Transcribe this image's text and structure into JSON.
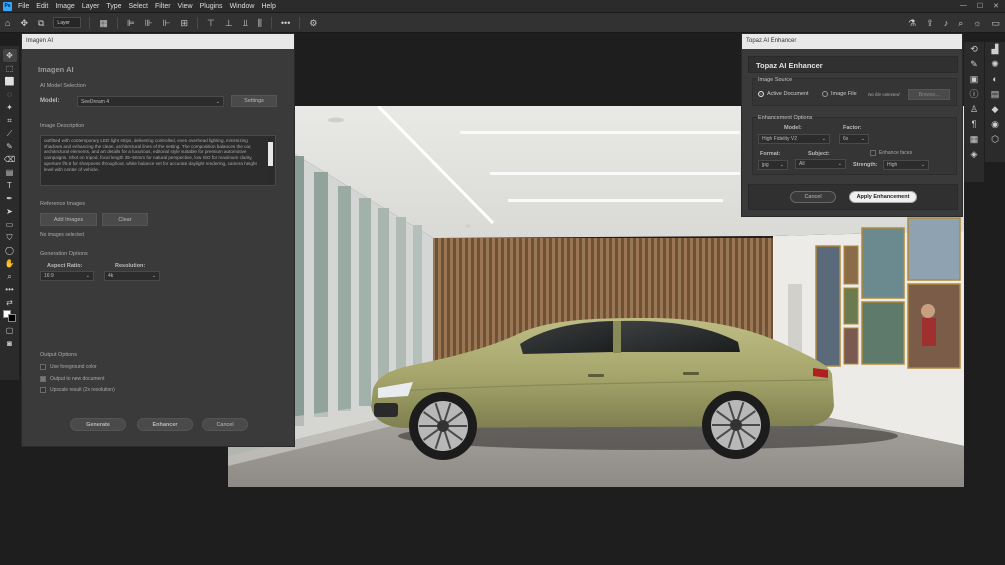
{
  "menubar": {
    "logo": "Ps",
    "items": [
      "File",
      "Edit",
      "Image",
      "Layer",
      "Type",
      "Select",
      "Filter",
      "View",
      "Plugins",
      "Window",
      "Help"
    ],
    "window_controls": [
      "—",
      "☐",
      "✕"
    ]
  },
  "options_bar": {
    "layer_select": "Layer",
    "icons": [
      "home-icon",
      "move-icon",
      "auto-select-icon",
      "transform-icon",
      "align-left-icon",
      "align-center-icon",
      "align-right-icon",
      "distribute-icon",
      "more-icon",
      "settings-icon"
    ],
    "right_icons": [
      "flask-icon",
      "share-icon",
      "bell-icon",
      "search-icon",
      "lightbulb-icon",
      "layout-icon"
    ]
  },
  "imagen_panel": {
    "window_title": "Imagen AI",
    "header": "Imagen AI",
    "model_section": {
      "title": "AI Model Selection",
      "model_label": "Model:",
      "model_value": "SeeDream 4",
      "settings_button": "Settings"
    },
    "description_section": {
      "title": "Image Description",
      "text": "outfitted with contemporary LED light strips, delivering controlled, even overhead lighting, minimizing shadows and enhancing the clean, architectural lines of the setting. The composition balances the car, architectural elements, and art details for a luxurious, editorial style suitable for premium automotive campaigns. Shot on tripod, focal length 35–50mm for natural perspective, low ISO for maximum clarity, aperture f/5.6 for sharpness throughout, white balance set for accurate daylight rendering, camera height level with center of vehicle."
    },
    "reference_section": {
      "title": "Reference Images",
      "add_button": "Add Images",
      "clear_button": "Clear",
      "status": "No images selected"
    },
    "generation_section": {
      "title": "Generation Options",
      "aspect_label": "Aspect Ratio:",
      "aspect_value": "16:9",
      "resolution_label": "Resolution:",
      "resolution_value": "4k"
    },
    "output_section": {
      "title": "Output Options",
      "options": [
        {
          "label": "Use foreground color",
          "checked": false
        },
        {
          "label": "Output to new document",
          "checked": true
        },
        {
          "label": "Upscale result (2x resolution)",
          "checked": false
        }
      ]
    },
    "buttons": {
      "generate": "Generate",
      "enhancer": "Enhancer",
      "cancel": "Cancel"
    }
  },
  "topaz_panel": {
    "window_title": "Topaz AI Enhancer",
    "header": "Topaz AI Enhancer",
    "source_section": {
      "title": "Image Source",
      "active_doc": "Active Document",
      "image_file": "Image File",
      "no_file": "No file selected",
      "browse_button": "Browse..."
    },
    "options_section": {
      "title": "Enhancement Options",
      "model_label": "Model:",
      "model_value": "High Fidelity V2",
      "factor_label": "Factor:",
      "factor_value": "6x",
      "format_label": "Format:",
      "format_value": "jpg",
      "subject_label": "Subject:",
      "subject_value": "All",
      "enhance_faces": "Enhance faces",
      "strength_label": "Strength:",
      "strength_value": "High"
    },
    "buttons": {
      "cancel": "Cancel",
      "apply": "Apply Enhancement"
    }
  },
  "colors": {
    "app_bg": "#1e1e1e",
    "panel_bg": "#3a3a3a",
    "accent": "#31a8ff",
    "car": "#a6a66a"
  }
}
